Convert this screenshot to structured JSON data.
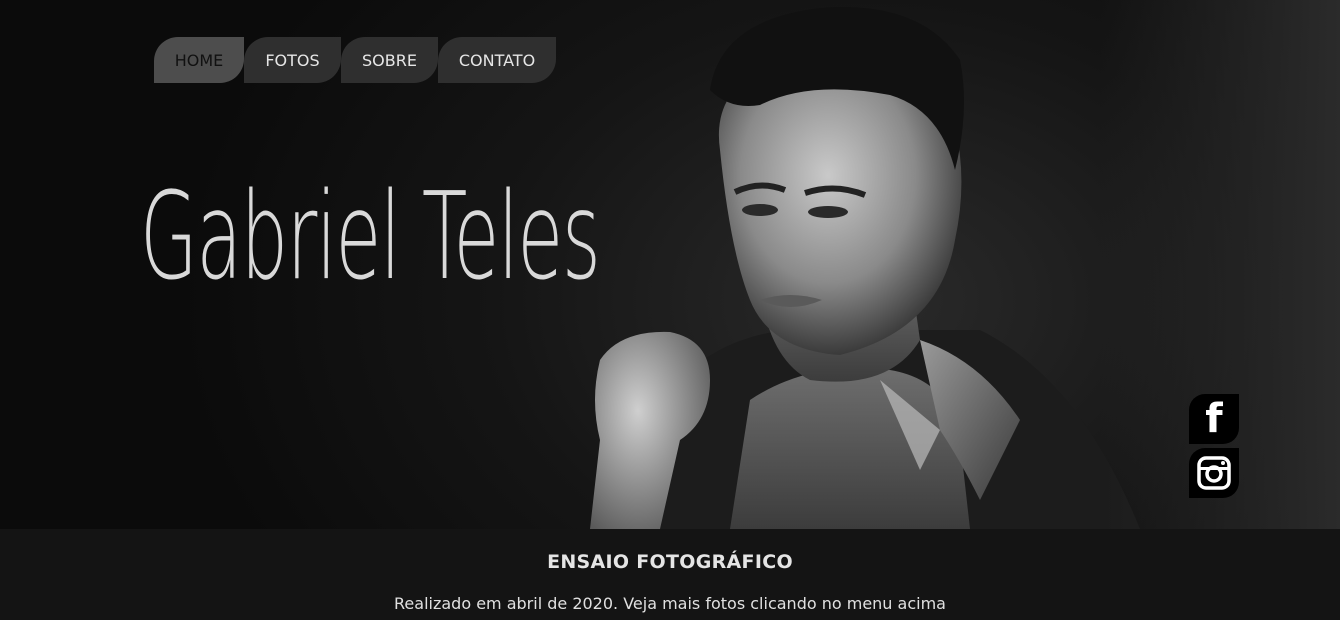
{
  "nav": {
    "items": [
      {
        "label": "HOME",
        "active": true
      },
      {
        "label": "FOTOS",
        "active": false
      },
      {
        "label": "SOBRE",
        "active": false
      },
      {
        "label": "CONTATO",
        "active": false
      }
    ]
  },
  "hero": {
    "name": "Gabriel Teles",
    "image": "black-and-white portrait photo of a young man"
  },
  "social": {
    "icons": [
      "facebook-icon",
      "instagram-icon"
    ]
  },
  "footer": {
    "title": "ENSAIO FOTOGRÁFICO",
    "text": "Realizado em abril de 2020. Veja mais fotos clicando no menu acima"
  },
  "colors": {
    "background": "#141414",
    "nav_active": "#4d4d4d",
    "nav_item": "#2f2f2f",
    "social_bg": "#000000"
  }
}
